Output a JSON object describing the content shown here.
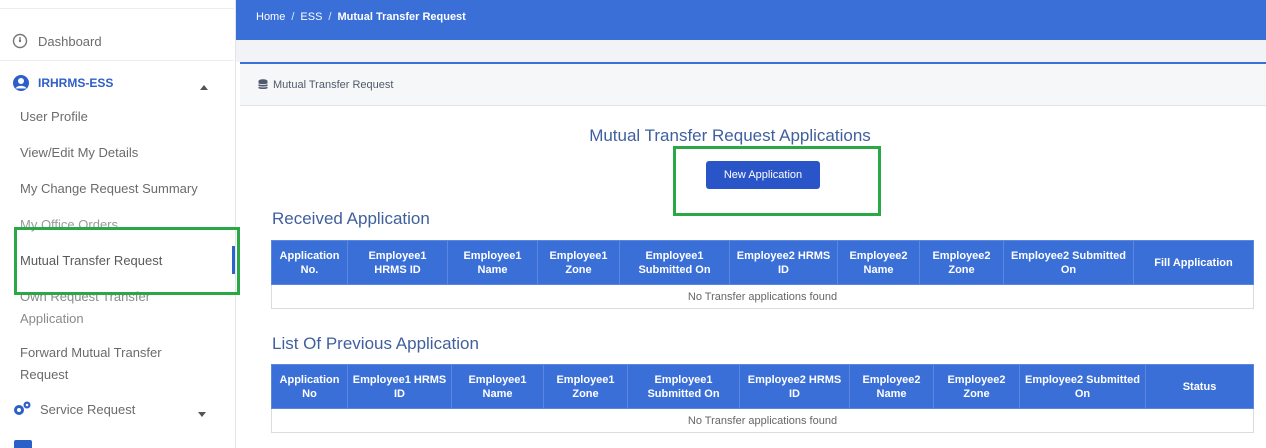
{
  "breadcrumb": {
    "home": "Home",
    "sep": "/",
    "ess": "ESS",
    "current": "Mutual Transfer Request"
  },
  "sidebar": {
    "dashboard": "Dashboard",
    "section": "IRHRMS-ESS",
    "items": [
      "User Profile",
      "View/Edit My Details",
      "My Change Request Summary",
      "My Office Orders",
      "Mutual Transfer Request",
      "Own Request Transfer Application",
      "Forward Mutual Transfer Request"
    ],
    "service": "Service Request"
  },
  "panel": {
    "header": "Mutual Transfer Request"
  },
  "main": {
    "title": "Mutual Transfer Request Applications",
    "new_button": "New Application",
    "received_title": "Received Application",
    "previous_title": "List Of Previous Application",
    "received_columns": [
      "Application No.",
      "Employee1 HRMS ID",
      "Employee1 Name",
      "Employee1 Zone",
      "Employee1 Submitted On",
      "Employee2 HRMS ID",
      "Employee2 Name",
      "Employee2 Zone",
      "Employee2 Submitted On",
      "Fill Application"
    ],
    "previous_columns": [
      "Application No",
      "Employee1 HRMS ID",
      "Employee1 Name",
      "Employee1 Zone",
      "Employee1 Submitted On",
      "Employee2 HRMS ID",
      "Employee2 Name",
      "Employee2 Zone",
      "Employee2 Submitted On",
      "Status"
    ],
    "empty_message": "No Transfer applications found"
  },
  "colors": {
    "accent": "#3a6fd8",
    "button": "#2a55c8",
    "highlight": "#2aa845"
  }
}
